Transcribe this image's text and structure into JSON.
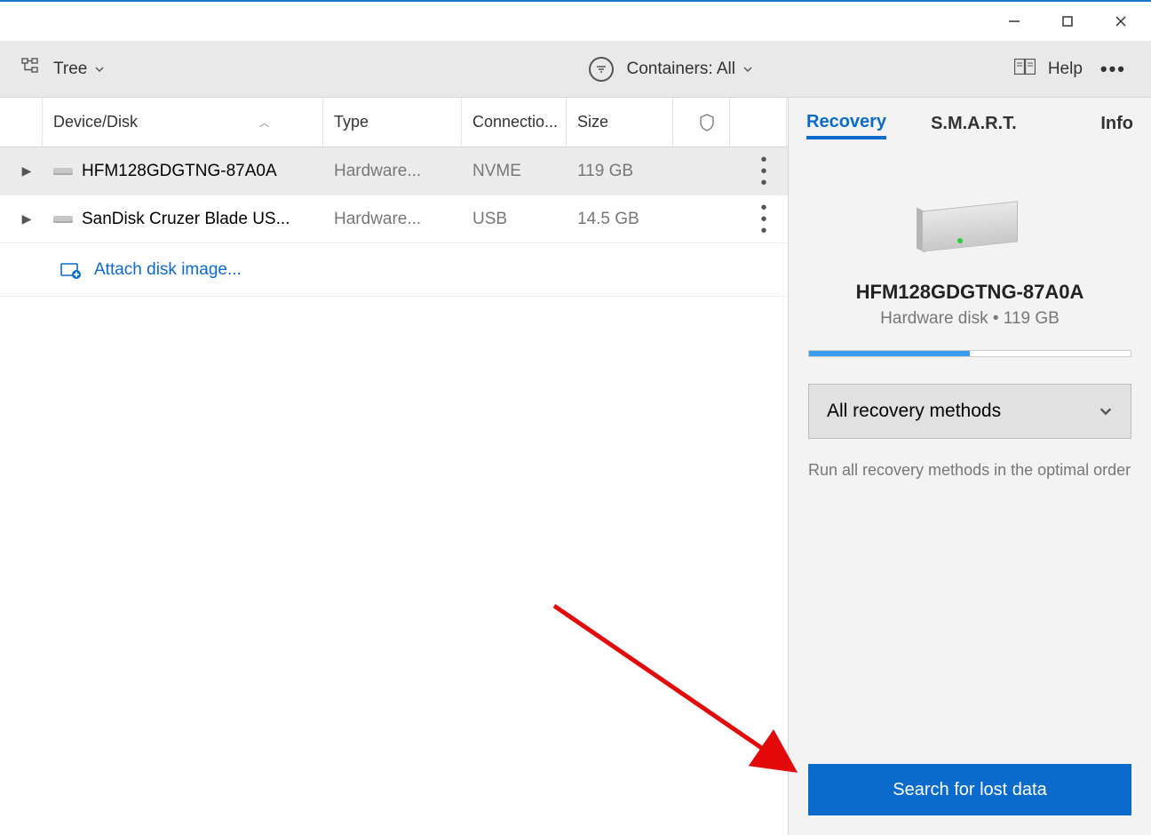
{
  "titlebar": {
    "minimize": "—",
    "maximize": "□",
    "close": "✕"
  },
  "toolbar": {
    "view_mode_label": "Tree",
    "containers_label": "Containers: All",
    "help_label": "Help"
  },
  "table": {
    "headers": {
      "device": "Device/Disk",
      "type": "Type",
      "connection": "Connectio...",
      "size": "Size"
    },
    "rows": [
      {
        "device": "HFM128GDGTNG-87A0A",
        "type": "Hardware...",
        "connection": "NVME",
        "size": "119 GB",
        "selected": true
      },
      {
        "device": "SanDisk Cruzer Blade US...",
        "type": "Hardware...",
        "connection": "USB",
        "size": "14.5 GB",
        "selected": false
      }
    ],
    "attach_label": "Attach disk image..."
  },
  "panel": {
    "tabs": {
      "recovery": "Recovery",
      "smart": "S.M.A.R.T.",
      "info": "Info"
    },
    "disk_name": "HFM128GDGTNG-87A0A",
    "disk_subtitle": "Hardware disk • 119 GB",
    "progress_percent": 50,
    "method_label": "All recovery methods",
    "method_desc": "Run all recovery methods in the optimal order",
    "search_button": "Search for lost data"
  }
}
